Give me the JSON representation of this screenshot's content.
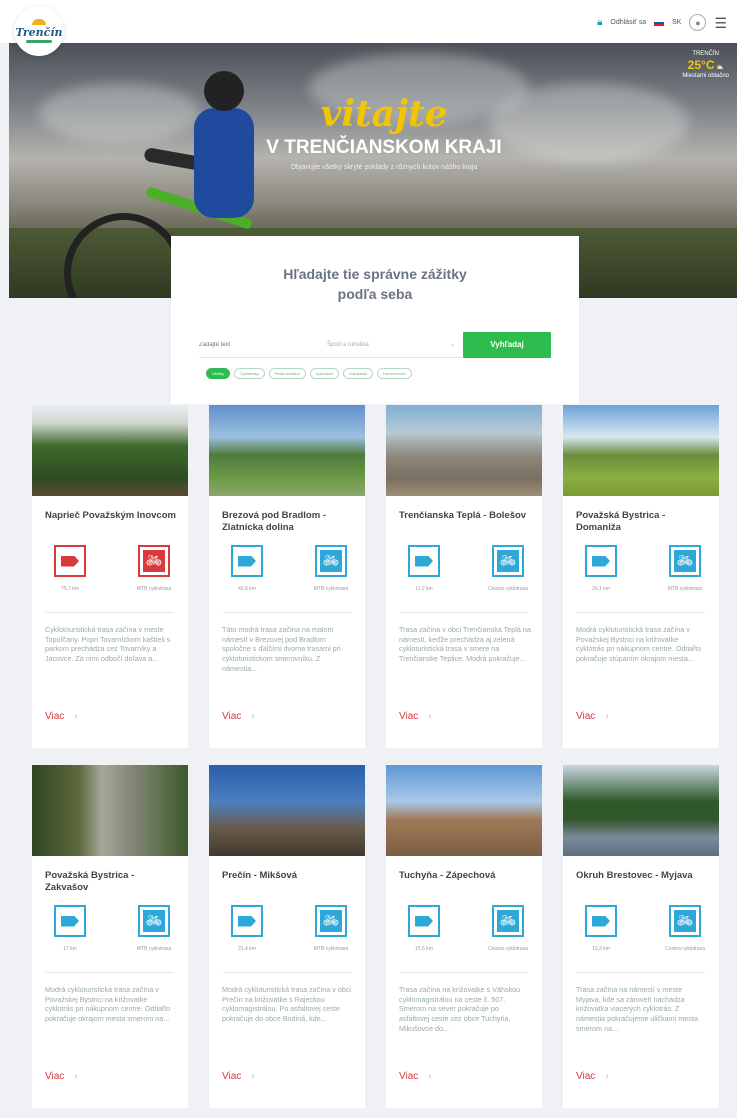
{
  "header": {
    "logo_text": "Trenčín",
    "logout_label": "Odhlásiť sa",
    "language_label": "SK"
  },
  "weather": {
    "city": "TRENČÍN",
    "temp": "25°C",
    "detail": "Miestami oblačno"
  },
  "hero": {
    "script_title": "vitajte",
    "title": "V TRENČIANSKOM KRAJI",
    "subtitle": "Objavujte všetky skryté poklady z rôznych kútov nášho kraja"
  },
  "search": {
    "title_line1": "Hľadajte tie správne zážitky",
    "title_line2": "podľa seba",
    "input_placeholder": "Zadajte text",
    "select_value": "Šport a turistika",
    "button_label": "Vyhľadaj",
    "chips": [
      "Všetky",
      "Cyklotrasy",
      "Pešia turistika",
      "Lyžovanie",
      "Kúpaliská",
      "Horolezectvo"
    ]
  },
  "cards": [
    {
      "title": "Naprieč Považským Inovcom",
      "distance": "75,7 km",
      "type": "MTB cyklotrasa",
      "desc": "Cyklotouristická trasa začína v meste Topoľčany. Popri Tovarníckom kaštieli s parkom prechádza cez Tovarníky a Jacovce. Za nimi odbočí doľava a...",
      "more": "Viac"
    },
    {
      "title": "Brezová pod Bradlom - Zlatnícka dolina",
      "distance": "42,8 km",
      "type": "MTB cyklotrasa",
      "desc": "Táto modrá trasa začína na malom námestí v Brezovej pod Bradlom spoločne s ďalšími dvoma trasami pri cykloturistickom smerovníku. Z námestia...",
      "more": "Viac"
    },
    {
      "title": "Trenčianska Teplá - Bolešov",
      "distance": "11,2 km",
      "type": "Cestná cyklotrasa",
      "desc": "Trasa začína v obci Trenčianska Teplá na námestí, keďže prechádza aj zelená cykloturistická trasa v smere na Trenčianske Teplice. Modrá pokračuje...",
      "more": "Viac"
    },
    {
      "title": "Považská Bystrica - Domaniža",
      "distance": "26,1 km",
      "type": "MTB cyklotrasa",
      "desc": "Modrá cykloturistická trasa začína v Považskej Bystrici na križovatke cyklotrás pri nákupnom centre. Odtiaľto pokračuje stúpaním okrajom mesta...",
      "more": "Viac"
    },
    {
      "title": "Považská Bystrica - Zakvašov",
      "distance": "17 km",
      "type": "MTB cyklotrasa",
      "desc": "Modrá cykloturistická trasa začína v Považskej Bystrici na križovatke cyklotrás pri nákupnom centre. Odtiaľto pokračuje okrajom mesta smerom na...",
      "more": "Viac"
    },
    {
      "title": "Prečín - Mikšová",
      "distance": "21,4 km",
      "type": "MTB cyklotrasa",
      "desc": "Modrá cykloturistická trasa začína v obci Prečín na križovatke s Rajeckou cyklomagistrálou. Po asfaltovej ceste pokračuje do obce Bodiná, kde...",
      "more": "Viac"
    },
    {
      "title": "Tuchyňa - Zápechová",
      "distance": "15,5 km",
      "type": "Cestná cyklotrasa",
      "desc": "Trasa začína na križovatke s Váhskou cyklomagistrálou na ceste č. 507. Smerom na sever pokračuje po asfaltovej ceste cez obce Tuchyňa, Mikušovce do...",
      "more": "Viac"
    },
    {
      "title": "Okruh Brestovec - Myjava",
      "distance": "15,3 km",
      "type": "Cestná cyklotrasa",
      "desc": "Trasa začína na námestí v meste Myjava, kde sa zároveň nachádza križovatka viacerých cyklotrás. Z námestia pokračujeme uličkami mesta smerom na...",
      "more": "Viac"
    }
  ],
  "colors": {
    "accent_green": "#2dbd4e",
    "route_blue": "#2ea8d8",
    "route_red": "#d8393b",
    "hero_yellow": "#f2c500"
  }
}
